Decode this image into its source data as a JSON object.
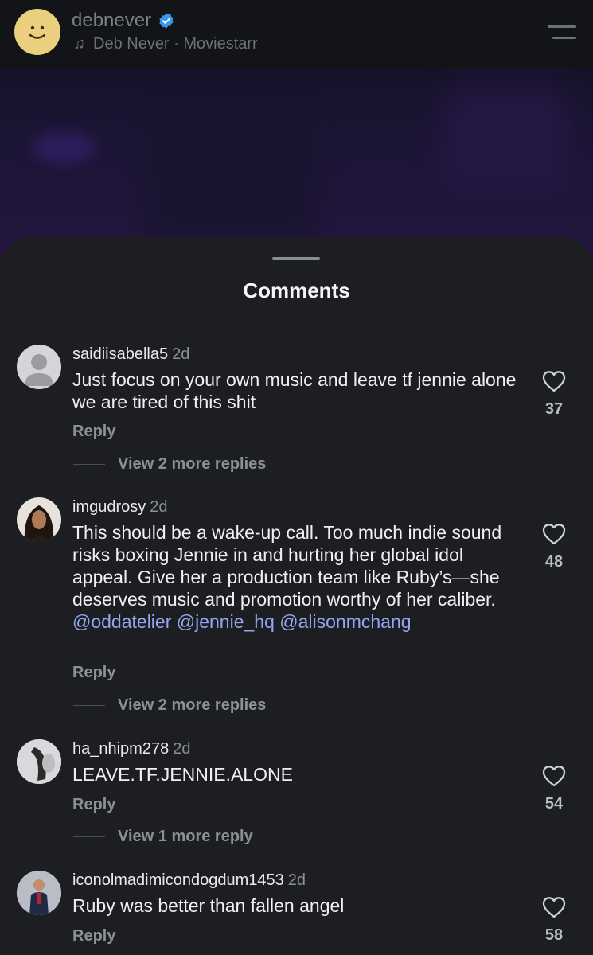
{
  "header": {
    "username": "debnever",
    "music": "Deb Never · Moviestarr"
  },
  "sheet": {
    "title": "Comments"
  },
  "comments": [
    {
      "username": "saidiisabella5",
      "time": "2d",
      "text_parts": [
        "Just focus on your own music and leave tf jennie alone we are tired of this shit"
      ],
      "mentions": [],
      "reply": "Reply",
      "view_more": "View 2 more replies",
      "likes": "37"
    },
    {
      "username": "imgudrosy",
      "time": "2d",
      "text_parts": [
        "This should be a wake-up call. Too much indie sound risks boxing Jennie in and hurting her global idol appeal. Give her a production team like Ruby’s—she deserves music and promotion worthy of her caliber."
      ],
      "mentions": [
        "@oddatelier",
        "@jennie_hq",
        "@alisonmchang"
      ],
      "reply": "Reply",
      "view_more": "View 2 more replies",
      "likes": "48"
    },
    {
      "username": "ha_nhipm278",
      "time": "2d",
      "text_parts": [
        "LEAVE.TF.JENNIE.ALONE"
      ],
      "mentions": [],
      "reply": "Reply",
      "view_more": "View 1 more reply",
      "likes": "54"
    },
    {
      "username": "iconolmadimicondogdum1453",
      "time": "2d",
      "text_parts": [
        "Ruby was better than fallen angel"
      ],
      "mentions": [],
      "reply": "Reply",
      "view_more": "",
      "likes": "58"
    }
  ],
  "colors": {
    "background": "#1c1e21",
    "mention": "#93a7f2",
    "muted": "#8c8f95",
    "verified": "#3897f0"
  }
}
